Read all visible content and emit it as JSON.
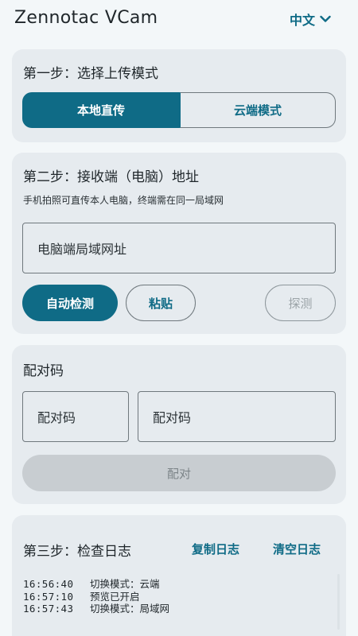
{
  "header": {
    "title": "Zennotac VCam",
    "language": "中文",
    "language_icon": "chevron-down-icon"
  },
  "step1": {
    "title": "第一步：选择上传模式",
    "options": [
      "本地直传",
      "云端模式"
    ],
    "selected": "本地直传"
  },
  "step2": {
    "title": "第二步：接收端（电脑）地址",
    "subtitle": "手机拍照可直传本人电脑，终端需在同一局域网",
    "address_placeholder": "电脑端局域网址",
    "auto_detect": "自动检测",
    "paste": "粘贴",
    "probe": "探测"
  },
  "pairing": {
    "title": "配对码",
    "field1_placeholder": "配对码",
    "field2_placeholder": "配对码",
    "pair_button": "配对"
  },
  "step3": {
    "title": "第三步：检查日志",
    "copy_log": "复制日志",
    "clear_log": "清空日志",
    "logs": [
      {
        "time": "16:56:40",
        "message": "切换模式：云端"
      },
      {
        "time": "16:57:10",
        "message": "预览已开启"
      },
      {
        "time": "16:57:43",
        "message": "切换模式：局域网"
      }
    ]
  },
  "colors": {
    "accent": "#0f6b86",
    "card": "#e6ebef",
    "background": "#f3f7f9",
    "disabled": "#c8cdd1"
  }
}
